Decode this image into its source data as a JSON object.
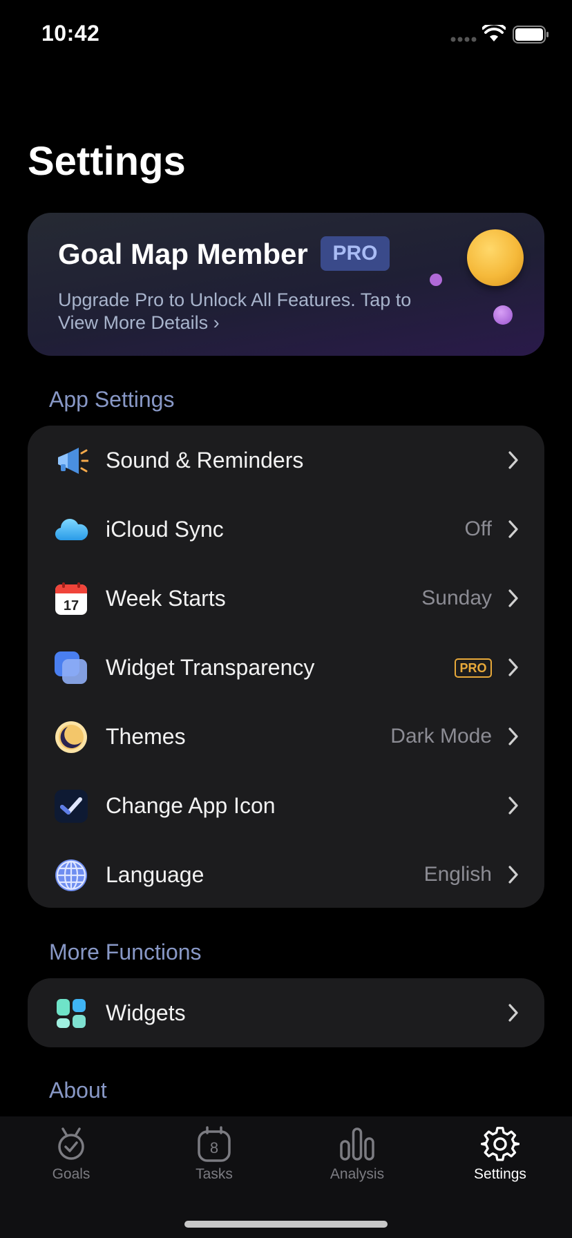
{
  "status": {
    "time": "10:42"
  },
  "page": {
    "title": "Settings"
  },
  "member": {
    "title": "Goal Map Member",
    "badge": "PRO",
    "subtitle": "Upgrade Pro to Unlock All Features. Tap to View More Details ›"
  },
  "sections": {
    "app_settings": "App Settings",
    "more_functions": "More Functions",
    "about": "About"
  },
  "app_settings": [
    {
      "label": "Sound & Reminders",
      "value": "",
      "icon": "megaphone-icon"
    },
    {
      "label": "iCloud Sync",
      "value": "Off",
      "icon": "cloud-icon"
    },
    {
      "label": "Week Starts",
      "value": "Sunday",
      "icon": "calendar-icon",
      "icon_text": "17"
    },
    {
      "label": "Widget Transparency",
      "value": "",
      "badge": "PRO",
      "icon": "transparency-icon"
    },
    {
      "label": "Themes",
      "value": "Dark Mode",
      "icon": "moon-icon"
    },
    {
      "label": "Change App Icon",
      "value": "",
      "icon": "checkmark-app-icon"
    },
    {
      "label": "Language",
      "value": "English",
      "icon": "globe-icon"
    }
  ],
  "more_functions": [
    {
      "label": "Widgets",
      "value": "",
      "icon": "widgets-icon"
    }
  ],
  "tabs": [
    {
      "label": "Goals",
      "icon": "medal-icon",
      "active": false
    },
    {
      "label": "Tasks",
      "icon": "timer-icon",
      "icon_text": "8",
      "active": false
    },
    {
      "label": "Analysis",
      "icon": "bar-chart-icon",
      "active": false
    },
    {
      "label": "Settings",
      "icon": "gear-icon",
      "active": true
    }
  ],
  "colors": {
    "background": "#000000",
    "group": "#1c1c1e",
    "section_label": "#8898c6",
    "pro_accent": "#e8a93a",
    "pro_badge": "#3a4a8a"
  }
}
